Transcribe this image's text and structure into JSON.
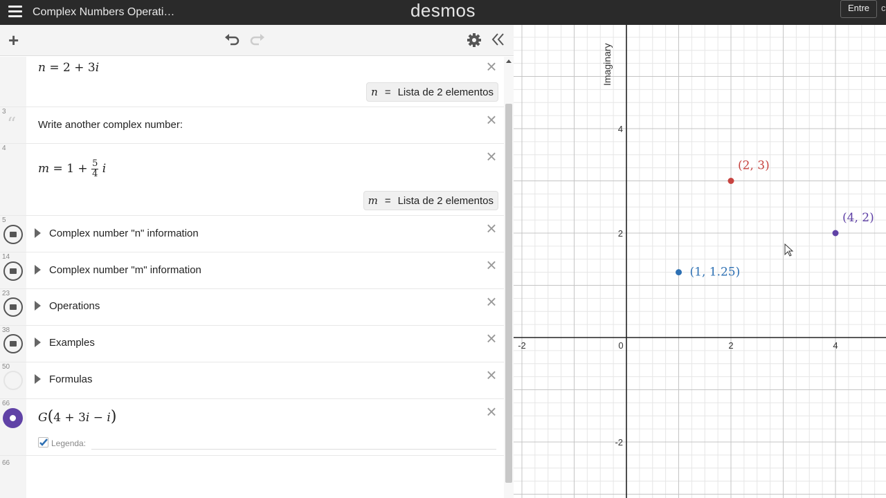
{
  "header": {
    "doc_title": "Complex Numbers Operati…",
    "brand": "desmos",
    "signin_label": "Entre",
    "edge_char": "c"
  },
  "toolbar": {
    "add_icon": "plus-icon",
    "undo_icon": "undo-icon",
    "redo_icon": "redo-icon",
    "settings_icon": "gear-icon",
    "collapse_icon": "double-chevron-left-icon"
  },
  "expressions": {
    "row_n": {
      "lhs": "n",
      "rhs_a": "2",
      "rhs_b": "3",
      "imag": "i",
      "pill_var": "n",
      "pill_text": "Lista de 2 elementos"
    },
    "row_note": {
      "number": "3",
      "text": "Write another complex number:"
    },
    "row_m": {
      "number": "4",
      "lhs": "m",
      "rhs_a": "1",
      "frac_num": "5",
      "frac_den": "4",
      "imag": "i",
      "pill_var": "m",
      "pill_text": "Lista de 2 elementos"
    },
    "folders": [
      {
        "number": "5",
        "title": "Complex number \"n\" information"
      },
      {
        "number": "14",
        "title": "Complex number \"m\" information"
      },
      {
        "number": "23",
        "title": "Operations"
      },
      {
        "number": "38",
        "title": "Examples"
      },
      {
        "number": "50",
        "title": "Formulas"
      }
    ],
    "row_g": {
      "number": "66",
      "func": "G",
      "arg_a": "4",
      "arg_b": "3",
      "arg_c": "i",
      "legend_label": "Legenda:"
    },
    "row_empty": {
      "number": "66"
    }
  },
  "graph": {
    "y_axis_label": "Imaginary",
    "x_ticks": [
      "-2",
      "0",
      "2",
      "4"
    ],
    "y_ticks": [
      "4",
      "2",
      "-2"
    ],
    "points": [
      {
        "x": 2,
        "y": 3,
        "label": "(2, 3)",
        "color": "#c74440"
      },
      {
        "x": 4,
        "y": 2,
        "label": "(4, 2)",
        "color": "#6042a6"
      },
      {
        "x": 1,
        "y": 1.25,
        "label": "(1, 1.25)",
        "color": "#2d70b3"
      }
    ]
  },
  "colors": {
    "header_bg": "#2a2a2a",
    "active_expression": "#6042a6",
    "checkbox": "#2d70b3"
  }
}
